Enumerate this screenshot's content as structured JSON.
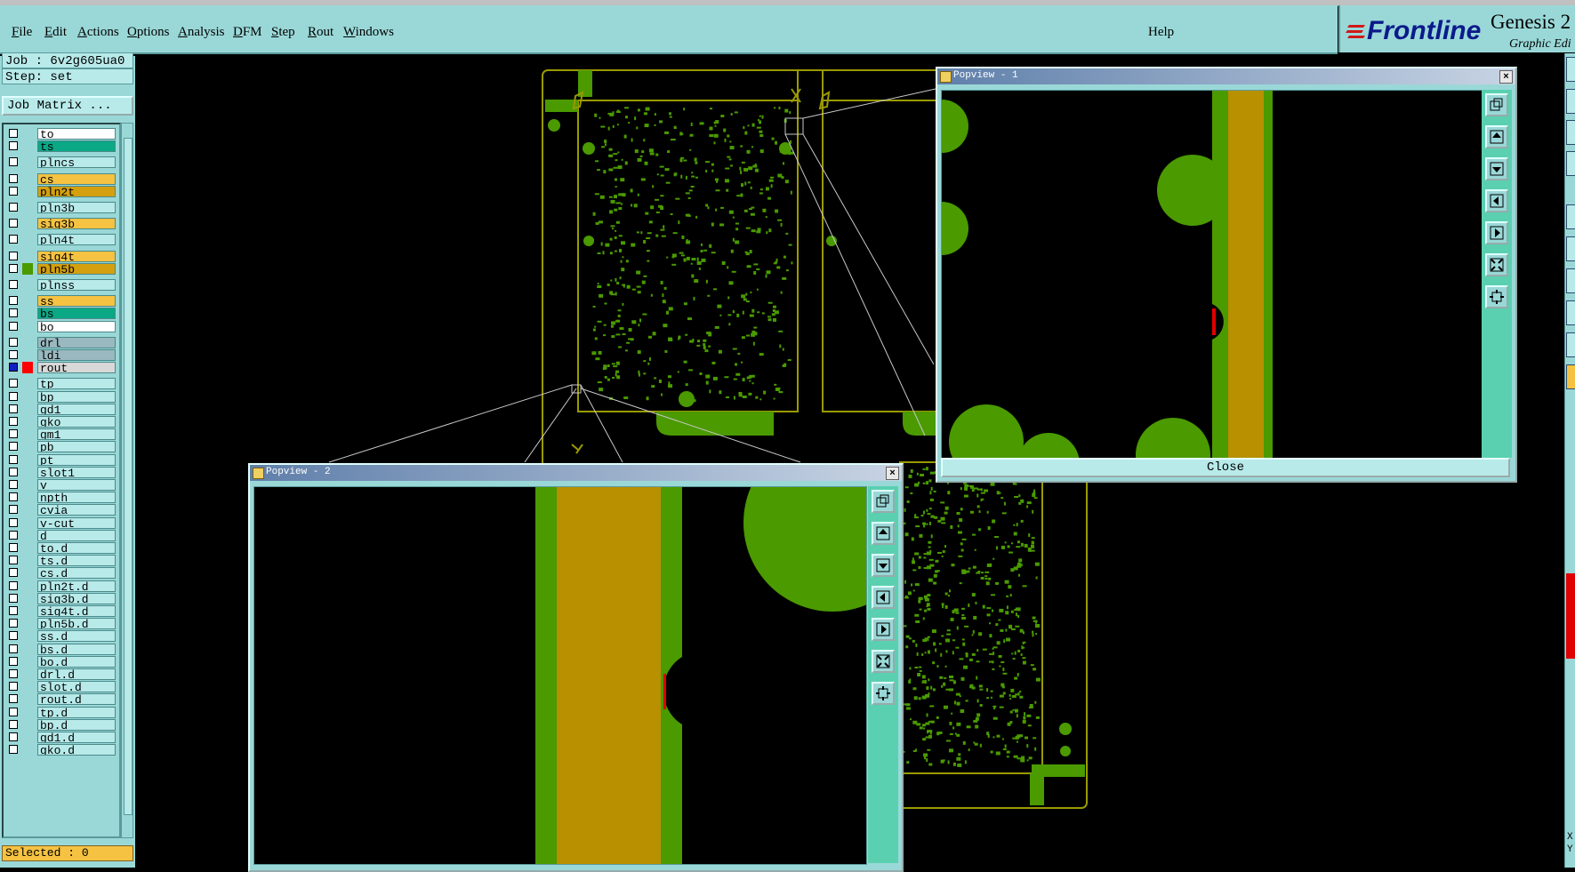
{
  "menu": {
    "items": [
      {
        "label": "File",
        "accel": "F",
        "rest": "ile"
      },
      {
        "label": "Edit",
        "accel": "E",
        "rest": "dit"
      },
      {
        "label": "Actions",
        "accel": "A",
        "rest": "ctions"
      },
      {
        "label": "Options",
        "accel": "O",
        "rest": "ptions"
      },
      {
        "label": "Analysis",
        "accel": "A",
        "rest": "nalysis"
      },
      {
        "label": "DFM",
        "accel": "D",
        "rest": "FM"
      },
      {
        "label": "Step",
        "accel": "S",
        "rest": "tep"
      },
      {
        "label": "Rout",
        "accel": "R",
        "rest": "out"
      },
      {
        "label": "Windows",
        "accel": "W",
        "rest": "indows"
      }
    ],
    "help": "Help"
  },
  "brand": {
    "logo": "Frontline",
    "app_name": "Genesis 2",
    "subtitle": "Graphic Edi"
  },
  "job": {
    "job_line": "Job : 6v2g605ua0",
    "step_line": "Step: set",
    "matrix_button": "Job Matrix ..."
  },
  "layers": [
    {
      "name": "to",
      "color": "#ffffff",
      "swatch": ""
    },
    {
      "name": "ts",
      "color": "#0aa885",
      "swatch": ""
    },
    {
      "name": "plncs",
      "color": "#b8eaea",
      "swatch": ""
    },
    {
      "name": "cs",
      "color": "#f5c242",
      "swatch": ""
    },
    {
      "name": "pln2t",
      "color": "#d4a010",
      "swatch": ""
    },
    {
      "name": "pln3b",
      "color": "#b8eaea",
      "swatch": ""
    },
    {
      "name": "sig3b",
      "color": "#f5c242",
      "swatch": ""
    },
    {
      "name": "pln4t",
      "color": "#b8eaea",
      "swatch": ""
    },
    {
      "name": "sig4t",
      "color": "#f5c242",
      "swatch": ""
    },
    {
      "name": "pln5b",
      "color": "#d4a010",
      "swatch": "#4a9a00"
    },
    {
      "name": "plnss",
      "color": "#b8eaea",
      "swatch": ""
    },
    {
      "name": "ss",
      "color": "#f5c242",
      "swatch": ""
    },
    {
      "name": "bs",
      "color": "#0aa885",
      "swatch": ""
    },
    {
      "name": "bo",
      "color": "#ffffff",
      "swatch": ""
    },
    {
      "name": "drl",
      "color": "#9ab8c0",
      "swatch": ""
    },
    {
      "name": "ldi",
      "color": "#9ab8c0",
      "swatch": ""
    },
    {
      "name": "rout",
      "color": "#d8d8d8",
      "swatch": "#ff0000",
      "active": true
    },
    {
      "name": "tp",
      "color": "#b8eaea",
      "swatch": ""
    },
    {
      "name": "bp",
      "color": "#b8eaea",
      "swatch": ""
    },
    {
      "name": "gd1",
      "color": "#b8eaea",
      "swatch": ""
    },
    {
      "name": "gko",
      "color": "#b8eaea",
      "swatch": ""
    },
    {
      "name": "gm1",
      "color": "#b8eaea",
      "swatch": ""
    },
    {
      "name": "pb",
      "color": "#b8eaea",
      "swatch": ""
    },
    {
      "name": "pt",
      "color": "#b8eaea",
      "swatch": ""
    },
    {
      "name": "slot1",
      "color": "#b8eaea",
      "swatch": ""
    },
    {
      "name": "v",
      "color": "#b8eaea",
      "swatch": ""
    },
    {
      "name": "npth",
      "color": "#b8eaea",
      "swatch": ""
    },
    {
      "name": "cvia",
      "color": "#b8eaea",
      "swatch": ""
    },
    {
      "name": "v-cut",
      "color": "#b8eaea",
      "swatch": ""
    },
    {
      "name": "d",
      "color": "#b8eaea",
      "swatch": ""
    },
    {
      "name": "to.d",
      "color": "#b8eaea",
      "swatch": ""
    },
    {
      "name": "ts.d",
      "color": "#b8eaea",
      "swatch": ""
    },
    {
      "name": "cs.d",
      "color": "#b8eaea",
      "swatch": ""
    },
    {
      "name": "pln2t.d",
      "color": "#b8eaea",
      "swatch": ""
    },
    {
      "name": "sig3b.d",
      "color": "#b8eaea",
      "swatch": ""
    },
    {
      "name": "sig4t.d",
      "color": "#b8eaea",
      "swatch": ""
    },
    {
      "name": "pln5b.d",
      "color": "#b8eaea",
      "swatch": ""
    },
    {
      "name": "ss.d",
      "color": "#b8eaea",
      "swatch": ""
    },
    {
      "name": "bs.d",
      "color": "#b8eaea",
      "swatch": ""
    },
    {
      "name": "bo.d",
      "color": "#b8eaea",
      "swatch": ""
    },
    {
      "name": "drl.d",
      "color": "#b8eaea",
      "swatch": ""
    },
    {
      "name": "slot.d",
      "color": "#b8eaea",
      "swatch": ""
    },
    {
      "name": "rout.d",
      "color": "#b8eaea",
      "swatch": ""
    },
    {
      "name": "tp.d",
      "color": "#b8eaea",
      "swatch": ""
    },
    {
      "name": "bp.d",
      "color": "#b8eaea",
      "swatch": ""
    },
    {
      "name": "gd1.d",
      "color": "#b8eaea",
      "swatch": ""
    },
    {
      "name": "gko.d",
      "color": "#b8eaea",
      "swatch": ""
    }
  ],
  "status": {
    "selected": "Selected : 0"
  },
  "popview1": {
    "title": "Popview - 1",
    "close_label": "Close"
  },
  "popview2": {
    "title": "Popview - 2"
  },
  "coords": {
    "x": "X",
    "y": "Y"
  },
  "colors": {
    "copper": "#4a9a00",
    "outline": "#9a9a00",
    "trace": "#b89000",
    "rout": "#ff0000",
    "panel": "#9ad8d8"
  }
}
